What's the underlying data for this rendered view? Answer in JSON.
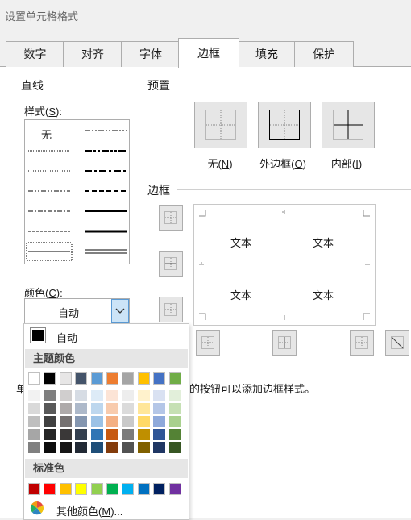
{
  "window": {
    "title": "设置单元格格式"
  },
  "tabs": [
    {
      "label": "数字",
      "active": false
    },
    {
      "label": "对齐",
      "active": false
    },
    {
      "label": "字体",
      "active": false
    },
    {
      "label": "边框",
      "active": true
    },
    {
      "label": "填充",
      "active": false
    },
    {
      "label": "保护",
      "active": false
    }
  ],
  "line_group": {
    "title": "直线",
    "style_label": "样式(",
    "style_key": "S",
    "style_none": "无",
    "color_label": "颜色(",
    "color_key": "C",
    "color_value": "自动"
  },
  "presets": {
    "title": "预置",
    "none": {
      "label": "无(",
      "key": "N"
    },
    "outline": {
      "label": "外边框(",
      "key": "O"
    },
    "inside": {
      "label": "内部(",
      "key": "I"
    }
  },
  "border": {
    "title": "边框",
    "preview_text": [
      "文本",
      "文本",
      "文本",
      "文本"
    ]
  },
  "note": {
    "visible_left": "单",
    "visible_right": "的按钮可以添加边框样式。"
  },
  "color_popup": {
    "auto_label": "自动",
    "theme_title": "主题颜色",
    "standard_title": "标准色",
    "more_label": "其他颜色(",
    "more_key": "M",
    "more_suffix": ")...",
    "theme_colors": [
      "#ffffff",
      "#000000",
      "#e7e6e6",
      "#44546a",
      "#5b9bd5",
      "#ed7d31",
      "#a5a5a5",
      "#ffc000",
      "#4472c4",
      "#70ad47"
    ],
    "theme_shades": [
      [
        "#f2f2f2",
        "#d9d9d9",
        "#bfbfbf",
        "#a6a6a6",
        "#808080"
      ],
      [
        "#7f7f7f",
        "#595959",
        "#404040",
        "#262626",
        "#0d0d0d"
      ],
      [
        "#d0cece",
        "#aeaaaa",
        "#757171",
        "#3a3838",
        "#171616"
      ],
      [
        "#d6dce4",
        "#adb9ca",
        "#8496b0",
        "#333f4f",
        "#222a35"
      ],
      [
        "#ddebf7",
        "#bdd7ee",
        "#9bc2e6",
        "#2f75b5",
        "#1f4e78"
      ],
      [
        "#fce4d6",
        "#f8cbad",
        "#f4b084",
        "#c65911",
        "#833c0c"
      ],
      [
        "#ededed",
        "#dbdbdb",
        "#c9c9c9",
        "#7b7b7b",
        "#525252"
      ],
      [
        "#fff2cc",
        "#ffe699",
        "#ffd966",
        "#bf8f00",
        "#806000"
      ],
      [
        "#d9e1f2",
        "#b4c6e7",
        "#8ea9db",
        "#2f5597",
        "#203764"
      ],
      [
        "#e2efda",
        "#c6e0b4",
        "#a9d08e",
        "#548235",
        "#375623"
      ]
    ],
    "standard_colors": [
      "#c00000",
      "#ff0000",
      "#ffc000",
      "#ffff00",
      "#92d050",
      "#00b050",
      "#00b0f0",
      "#0070c0",
      "#002060",
      "#7030a0"
    ]
  }
}
